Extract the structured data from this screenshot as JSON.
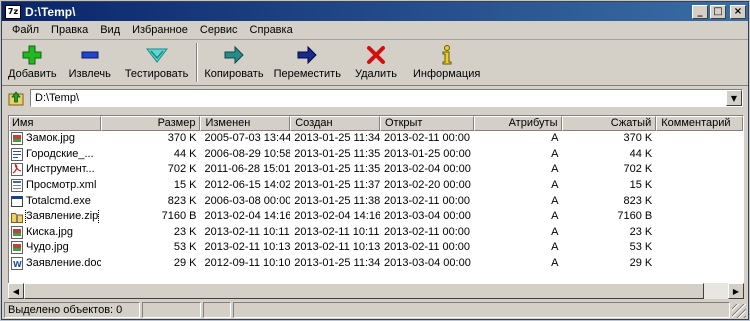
{
  "window": {
    "title": "D:\\Temp\\",
    "app_icon": "7z",
    "controls": {
      "minimize": "_",
      "maximize": "□",
      "close": "×"
    }
  },
  "menu": [
    "Файл",
    "Правка",
    "Вид",
    "Избранное",
    "Сервис",
    "Справка"
  ],
  "toolbar": {
    "add": "Добавить",
    "extract": "Извлечь",
    "test": "Тестировать",
    "copy": "Копировать",
    "move": "Переместить",
    "delete": "Удалить",
    "info": "Информация"
  },
  "address": {
    "value": "D:\\Temp\\"
  },
  "columns": [
    "Имя",
    "Размер",
    "Изменен",
    "Создан",
    "Открыт",
    "Атрибуты",
    "Сжатый",
    "Комментарий"
  ],
  "files": [
    {
      "name": "Замок.jpg",
      "size": "370 K",
      "modified": "2005-07-03 13:44",
      "created": "2013-01-25 11:34",
      "accessed": "2013-02-11 00:00",
      "attr": "A",
      "packed": "370 K",
      "comment": "",
      "icon": "image-icon"
    },
    {
      "name": "Городские_...",
      "size": "44 K",
      "modified": "2006-08-29 10:58",
      "created": "2013-01-25 11:35",
      "accessed": "2013-01-25 00:00",
      "attr": "A",
      "packed": "44 K",
      "comment": "",
      "icon": "doc-icon"
    },
    {
      "name": "Инструмент...",
      "size": "702 K",
      "modified": "2011-06-28 15:01",
      "created": "2013-01-25 11:35",
      "accessed": "2013-02-04 00:00",
      "attr": "A",
      "packed": "702 K",
      "comment": "",
      "icon": "pdf-icon"
    },
    {
      "name": "Просмотр.xml",
      "size": "15 K",
      "modified": "2012-06-15 14:02",
      "created": "2013-01-25 11:37",
      "accessed": "2013-02-20 00:00",
      "attr": "A",
      "packed": "15 K",
      "comment": "",
      "icon": "xml-icon"
    },
    {
      "name": "Totalcmd.exe",
      "size": "823 K",
      "modified": "2006-03-08 00:00",
      "created": "2013-01-25 11:38",
      "accessed": "2013-02-11 00:00",
      "attr": "A",
      "packed": "823 K",
      "comment": "",
      "icon": "exe-icon"
    },
    {
      "name": "Заявление.zip",
      "size": "7160 B",
      "modified": "2013-02-04 14:16",
      "created": "2013-02-04 14:16",
      "accessed": "2013-03-04 00:00",
      "attr": "A",
      "packed": "7160 B",
      "comment": "",
      "icon": "zip-icon"
    },
    {
      "name": "Киска.jpg",
      "size": "23 K",
      "modified": "2013-02-11 10:11",
      "created": "2013-02-11 10:11",
      "accessed": "2013-02-11 00:00",
      "attr": "A",
      "packed": "23 K",
      "comment": "",
      "icon": "image-icon"
    },
    {
      "name": "Чудо.jpg",
      "size": "53 K",
      "modified": "2013-02-11 10:13",
      "created": "2013-02-11 10:13",
      "accessed": "2013-02-11 00:00",
      "attr": "A",
      "packed": "53 K",
      "comment": "",
      "icon": "image-icon"
    },
    {
      "name": "Заявление.doc",
      "size": "29 K",
      "modified": "2012-09-11 10:10",
      "created": "2013-01-25 11:34",
      "accessed": "2013-03-04 00:00",
      "attr": "A",
      "packed": "29 K",
      "comment": "",
      "icon": "word-icon"
    }
  ],
  "status": {
    "selected": "Выделено объектов: 0"
  }
}
